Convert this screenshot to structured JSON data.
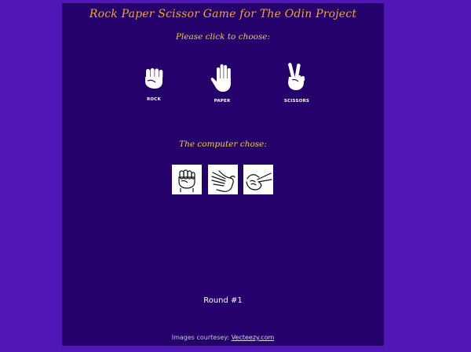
{
  "header": {
    "title": "Rock Paper Scissor Game for The Odin Project"
  },
  "player": {
    "prompt": "Please click to choose:",
    "choices": [
      {
        "label": "ROCK",
        "icon": "fist-icon"
      },
      {
        "label": "PAPER",
        "icon": "open-hand-icon"
      },
      {
        "label": "SCISSORS",
        "icon": "peace-sign-icon"
      }
    ]
  },
  "computer": {
    "prompt": "The computer chose:",
    "options": [
      {
        "icon": "fist-outline-icon"
      },
      {
        "icon": "hand-outline-icon"
      },
      {
        "icon": "peace-outline-icon"
      }
    ]
  },
  "status": {
    "round": "Round #1"
  },
  "footer": {
    "prefix": "Images courtesey: ",
    "link_text": "Vecteezy.com"
  },
  "colors": {
    "page_bg": "#5116b8",
    "panel_bg": "#24016b",
    "title": "#f3a72a",
    "prompt": "#f2d13a",
    "text": "#ffffff"
  }
}
